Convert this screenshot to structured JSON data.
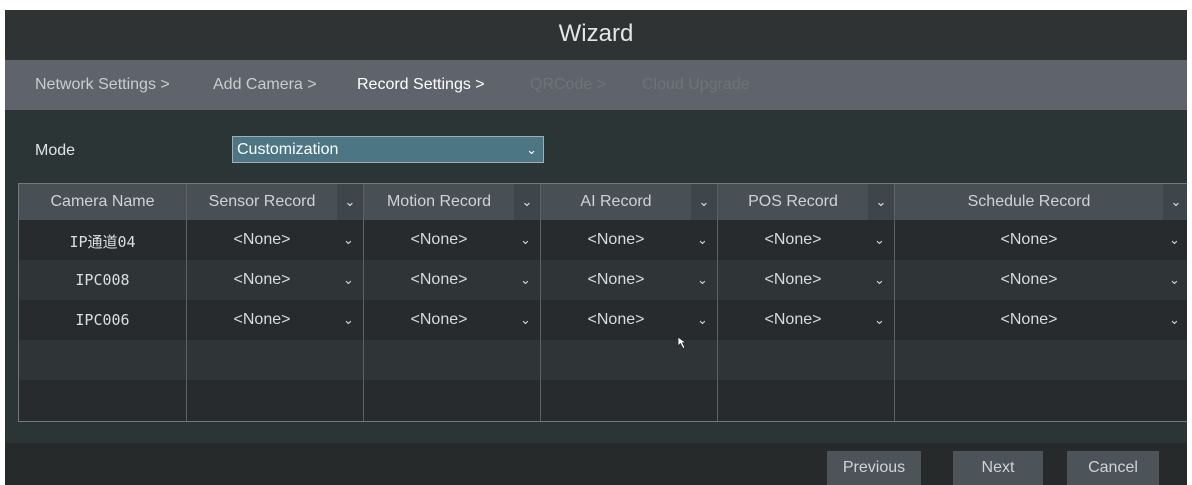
{
  "window": {
    "title": "Wizard"
  },
  "steps": [
    {
      "label": "Network Settings >",
      "state": "done"
    },
    {
      "label": "Add Camera >",
      "state": "done"
    },
    {
      "label": "Record Settings >",
      "state": "current"
    },
    {
      "label": "QRCode >",
      "state": "pending"
    },
    {
      "label": "Cloud Upgrade",
      "state": "pending"
    }
  ],
  "mode": {
    "label": "Mode",
    "value": "Customization"
  },
  "table": {
    "columns": [
      {
        "label": "Camera Name",
        "dropdown": false
      },
      {
        "label": "Sensor Record",
        "dropdown": true
      },
      {
        "label": "Motion Record",
        "dropdown": true
      },
      {
        "label": "AI Record",
        "dropdown": true
      },
      {
        "label": "POS Record",
        "dropdown": true
      },
      {
        "label": "Schedule Record",
        "dropdown": true
      }
    ],
    "rows": [
      {
        "camera": "IP通道04",
        "values": [
          "<None>",
          "<None>",
          "<None>",
          "<None>",
          "<None>"
        ]
      },
      {
        "camera": "IPC008",
        "values": [
          "<None>",
          "<None>",
          "<None>",
          "<None>",
          "<None>"
        ]
      },
      {
        "camera": "IPC006",
        "values": [
          "<None>",
          "<None>",
          "<None>",
          "<None>",
          "<None>"
        ]
      }
    ],
    "empty_rows": 2
  },
  "buttons": {
    "previous": "Previous",
    "next": "Next",
    "cancel": "Cancel"
  },
  "icons": {
    "dropdown": "chevron-down-icon",
    "cursor": "mouse-pointer-icon"
  },
  "colors": {
    "title_bar": "#2f3334",
    "steps_bar": "#5f646c",
    "content_bg": "#2c3535",
    "select_bg": "#4c7684",
    "header_bg": "#485055",
    "row_even": "#272b2d",
    "row_odd": "#2f3437",
    "button_bg": "#4c5459",
    "step_done": "#c9cdd0",
    "step_current": "#ffffff",
    "step_pending": "#6e7379"
  }
}
